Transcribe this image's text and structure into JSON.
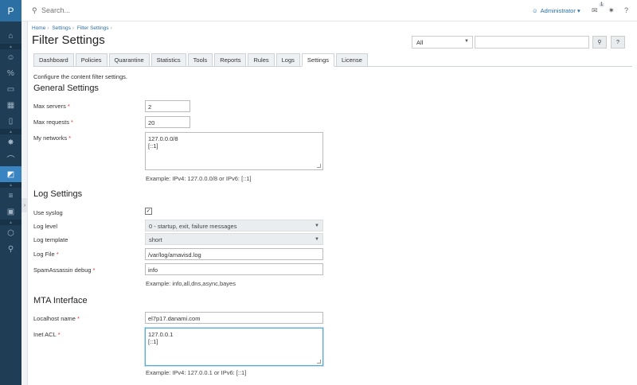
{
  "rail": {
    "logo": "P",
    "icons": [
      "home-icon",
      "user-icon",
      "percent-icon",
      "monitor-icon",
      "apps-icon",
      "book-icon",
      "chevron-icon",
      "gear-plugin-icon",
      "wifi-icon",
      "filter-icon",
      "sliders-icon",
      "grid-icon",
      "package-icon",
      "key-icon"
    ]
  },
  "topbar": {
    "search_placeholder": "Search...",
    "user": "Administrator",
    "notif_count": "1"
  },
  "breadcrumb": [
    "Home",
    "Settings",
    "Filter Settings"
  ],
  "page_title": "Filter Settings",
  "filter": {
    "selected": "All"
  },
  "tabs": [
    "Dashboard",
    "Policies",
    "Quarantine",
    "Statistics",
    "Tools",
    "Reports",
    "Rules",
    "Logs",
    "Settings",
    "License"
  ],
  "active_tab": "Settings",
  "intro": "Configure the content filter settings.",
  "general": {
    "title": "General Settings",
    "max_servers_label": "Max servers",
    "max_servers": "2",
    "max_requests_label": "Max requests",
    "max_requests": "20",
    "networks_label": "My networks",
    "networks": "127.0.0.0/8\n[::1]",
    "networks_hint": "Example: IPv4: 127.0.0.0/8 or IPv6: [::1]"
  },
  "log": {
    "title": "Log Settings",
    "syslog_label": "Use syslog",
    "syslog_checked": true,
    "level_label": "Log level",
    "level": "0 - startup, exit, failure messages",
    "template_label": "Log template",
    "template": "short",
    "file_label": "Log File",
    "file": "/var/log/amavisd.log",
    "sa_label": "SpamAssassin debug",
    "sa": "info",
    "sa_hint": "Example: info,all,dns,async,bayes"
  },
  "mta": {
    "title": "MTA Interface",
    "host_label": "Localhost name",
    "host": "el7p17.danami.com",
    "acl_label": "Inet ACL",
    "acl": "127.0.0.1\n[::1]",
    "acl_hint": "Example: IPv4: 127.0.0.1 or IPv6: [::1]"
  }
}
